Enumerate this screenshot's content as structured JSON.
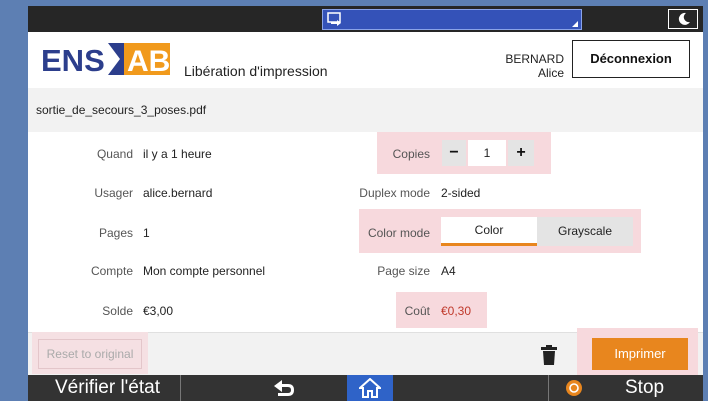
{
  "header": {
    "logo_text": "ENS AB",
    "app_title": "Libération d'impression",
    "user_name": "BERNARD Alice",
    "logout_label": "Déconnexion"
  },
  "file": {
    "name": "sortie_de_secours_3_poses.pdf"
  },
  "left_fields": [
    {
      "label": "Quand",
      "value": "il y a 1 heure"
    },
    {
      "label": "Usager",
      "value": "alice.bernard"
    },
    {
      "label": "Pages",
      "value": "1"
    },
    {
      "label": "Compte",
      "value": "Mon compte personnel"
    },
    {
      "label": "Solde",
      "value": "€3,00"
    }
  ],
  "right_fields": {
    "copies_label": "Copies",
    "copies_value": "1",
    "minus": "−",
    "plus": "+",
    "duplex_label": "Duplex mode",
    "duplex_value": "2-sided",
    "color_label": "Color mode",
    "color_options": [
      "Color",
      "Grayscale"
    ],
    "color_selected": "Color",
    "size_label": "Page size",
    "size_value": "A4",
    "cost_label": "Coût",
    "cost_value": "€0,30"
  },
  "actions": {
    "reset_label": "Reset to original",
    "print_label": "Imprimer"
  },
  "system_bar": {
    "status_label": "Vérifier l'état",
    "stop_label": "Stop"
  },
  "colors": {
    "accent_orange": "#e8861e",
    "highlight_pink": "#f7d9dd",
    "logo_blue": "#2c3e8c",
    "logo_orange": "#f19a1c"
  }
}
